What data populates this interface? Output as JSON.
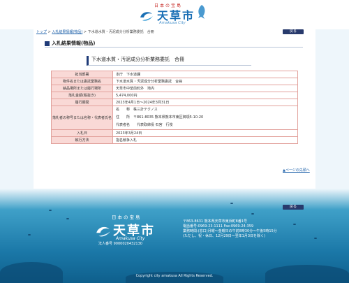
{
  "header": {
    "logo_tagline": "日本の宝島",
    "logo_name": "天草市",
    "logo_roman": "Amakusa City"
  },
  "breadcrumb": {
    "home": "トップ",
    "separator1": ">",
    "parent": "入札結果情報(物品)",
    "separator2": ">",
    "current": "下水道水質・汚泥成分分析業務委託　合冊"
  },
  "back_label": "戻る",
  "section_title": "入札結果情報(物品)",
  "page_title": "下水道水質・汚泥成分分析業務委託　合冊",
  "table": {
    "rows": [
      {
        "label": "担当部署",
        "value": "本庁　下水道課"
      },
      {
        "label": "物件名または委託業務名",
        "value": "下水道水質・汚泥成分分析業務委託　合冊"
      },
      {
        "label": "納品場所または履行場所",
        "value": "天草市中釜前町外　地内"
      },
      {
        "label": "落札金額(税抜き)",
        "value": "5,474,000円"
      },
      {
        "label": "履行期間",
        "value": "2023年4月1日～2024年3月31日"
      },
      {
        "label": "落札者の称号または名称・代表者氏名",
        "value_lines": [
          "名　　称　株三計テクノス",
          "住　　所　〒861-8035 熊本県熊本市東区御領5-10-20",
          "代表者名　　代表取締役 石宮　行俊"
        ]
      },
      {
        "label": "入札日",
        "value": "2023年3月24日"
      },
      {
        "label": "執行方法",
        "value": "指名競争入札"
      }
    ]
  },
  "to_top": "▲ページの先頭へ",
  "footer": {
    "tagline": "日本の宝島",
    "name": "天草市",
    "roman": "Amakusa City",
    "corp_no": "法人番号 9000020432130",
    "address_lines": [
      "〒863-8631 熊本県天草市東浜町8番1号",
      "電話番号:0969-23-1111 Fax:0969-24-359",
      "業務時間:(窓口)月曜～金曜日の午前8時30分～午後5時15分",
      "(ただし、祝・休日、12月29日～翌年1月3日を除く)"
    ],
    "copyright": "Copyright city amakusa All Rights Reserved."
  }
}
